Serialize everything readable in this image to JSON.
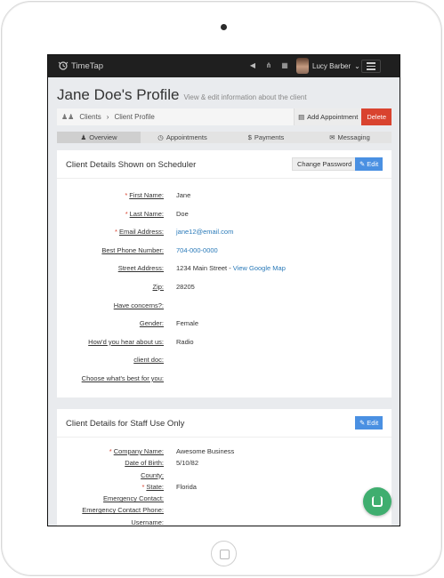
{
  "app": {
    "logo_text": "TimeTap"
  },
  "topbar": {
    "user_name": "Lucy Barber",
    "user_caret": "⌄"
  },
  "header": {
    "title": "Jane Doe's Profile",
    "subtitle": "View & edit information about the client"
  },
  "breadcrumb": {
    "root": "Clients",
    "separator": "›",
    "current": "Client Profile"
  },
  "actions": {
    "add_appointment": "Add Appointment",
    "delete": "Delete"
  },
  "tabs": [
    {
      "label": "Overview",
      "icon": "user-icon",
      "glyph": "♟"
    },
    {
      "label": "Appointments",
      "icon": "clock-icon",
      "glyph": "◷"
    },
    {
      "label": "Payments",
      "icon": "dollar-icon",
      "glyph": "$"
    },
    {
      "label": "Messaging",
      "icon": "envelope-icon",
      "glyph": "✉"
    }
  ],
  "scheduler_card": {
    "title": "Client Details Shown on Scheduler",
    "change_password": "Change Password",
    "edit": "Edit",
    "fields": [
      {
        "label": "First Name:",
        "value": "Jane"
      },
      {
        "label": "Last Name:",
        "value": "Doe"
      },
      {
        "label": "Email Address:",
        "value": "jane12@email.com"
      },
      {
        "label": "Best Phone Number:",
        "value": "704-000-0000"
      },
      {
        "label": "Street Address:",
        "value": "1234 Main Street - ",
        "link": "View Google Map"
      },
      {
        "label": "Zip:",
        "value": "28205"
      },
      {
        "label": "Have concerns?:",
        "value": ""
      },
      {
        "label": "Gender:",
        "value": "Female"
      },
      {
        "label": "How'd you hear about us:",
        "value": "Radio"
      },
      {
        "label": "client doc:",
        "value": ""
      },
      {
        "label": "Choose what's best for you:",
        "value": ""
      }
    ]
  },
  "staff_card": {
    "title": "Client Details for Staff Use Only",
    "edit": "Edit",
    "fields": [
      {
        "label": "Company Name:",
        "value": "Awesome Business"
      },
      {
        "label": "Date of Birth:",
        "value": "5/10/82"
      },
      {
        "label": "County:",
        "value": ""
      },
      {
        "label": "State:",
        "value": "Florida"
      },
      {
        "label": "Emergency Contact:",
        "value": ""
      },
      {
        "label": "Emergency Contact Phone:",
        "value": ""
      },
      {
        "label": "Username:",
        "value": ""
      }
    ]
  },
  "required_marker": "*",
  "colors": {
    "accent": "#4a90e2",
    "danger": "#d9432f",
    "link": "#2a7ab9",
    "chat": "#3fae6f",
    "topbar": "#1f1f1f"
  }
}
